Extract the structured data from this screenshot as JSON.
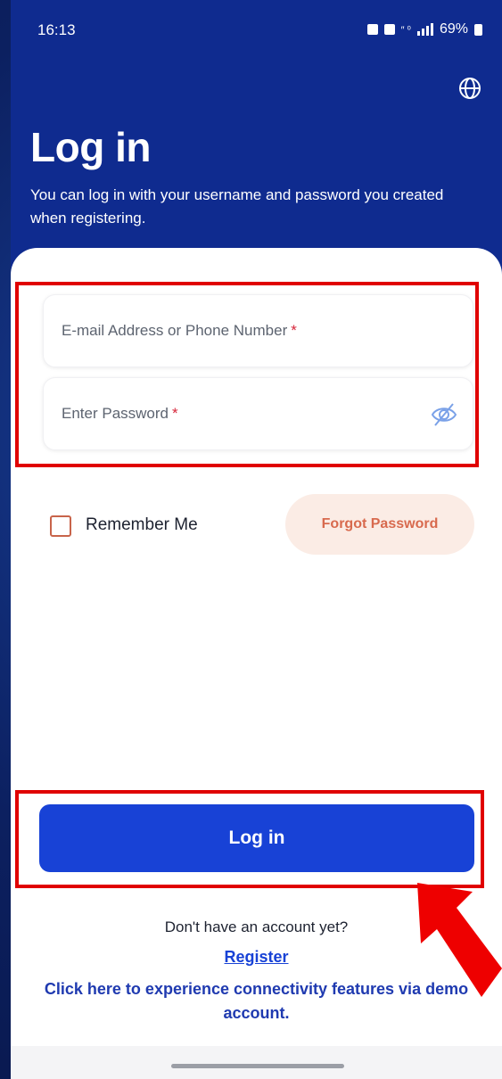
{
  "status_bar": {
    "time": "16:13",
    "network_text": "″ ⁰",
    "battery": "69%"
  },
  "header": {
    "language_icon": "globe-icon",
    "title": "Log in",
    "subtitle": "You can log in with your username and password you created when registering."
  },
  "form": {
    "email_placeholder": "E-mail Address or Phone Number",
    "password_placeholder": "Enter Password",
    "required_mark": "*",
    "password_toggle_icon": "eye-off-icon",
    "remember_label": "Remember Me",
    "remember_checked": false,
    "forgot_label": "Forgot Password",
    "login_label": "Log in"
  },
  "footer": {
    "no_account": "Don't have an account yet?",
    "register_label": "Register",
    "demo_text": "Click here to experience connectivity features via demo account."
  },
  "colors": {
    "header_bg": "#0f2b8f",
    "primary": "#1842d6",
    "forgot_text": "#d86a4e",
    "forgot_bg": "#fbece5",
    "highlight": "#e00000"
  }
}
